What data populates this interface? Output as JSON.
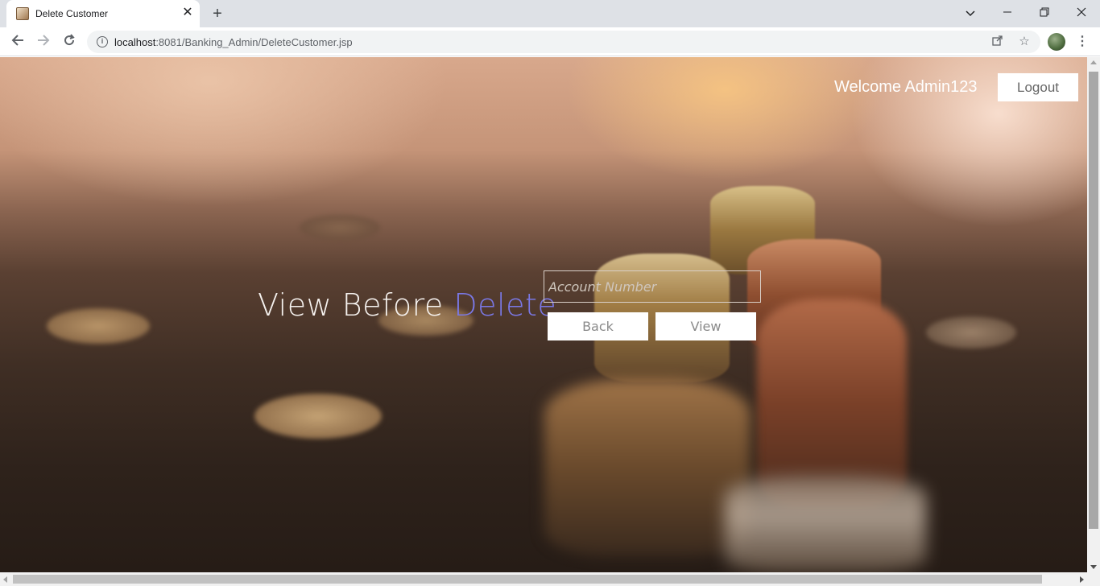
{
  "browser": {
    "tab_title": "Delete Customer",
    "tab_close": "✕",
    "new_tab": "+",
    "url_host": "localhost",
    "url_path": ":8081/Banking_Admin/DeleteCustomer.jsp",
    "icons": [
      "back-arrow-icon",
      "forward-arrow-icon",
      "reload-icon",
      "info-icon",
      "share-icon",
      "star-icon",
      "profile-avatar",
      "menu-dots-icon",
      "tab-search-icon",
      "minimize-icon",
      "restore-icon",
      "close-icon"
    ]
  },
  "header": {
    "welcome": "Welcome Admin123",
    "logout_label": "Logout"
  },
  "main": {
    "heading_prefix": "View Before ",
    "heading_accent": "Delete",
    "account_placeholder": "Account Number",
    "back_label": "Back",
    "view_label": "View"
  },
  "colors": {
    "accent": "#7a78e6",
    "button_bg": "#ffffff",
    "button_text": "#8a8a8a"
  }
}
